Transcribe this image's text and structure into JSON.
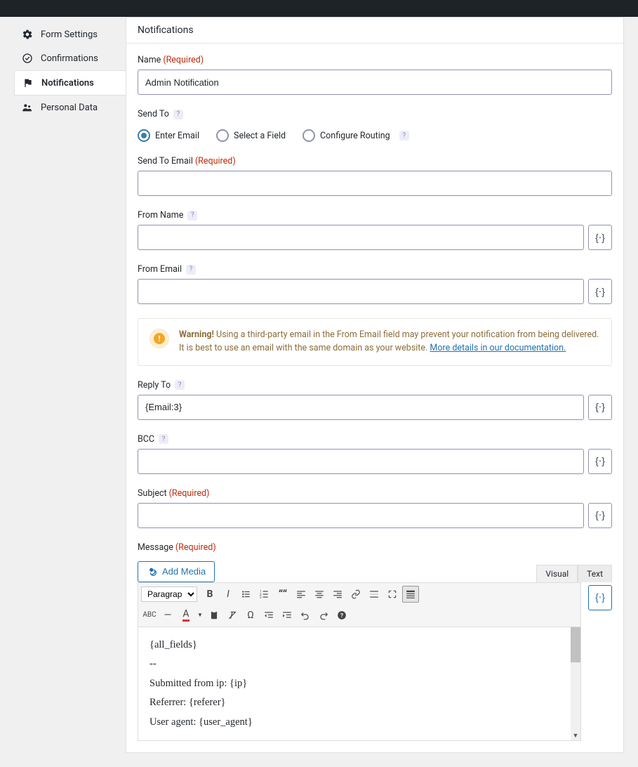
{
  "sidebar": {
    "items": [
      {
        "label": "Form Settings"
      },
      {
        "label": "Confirmations"
      },
      {
        "label": "Notifications"
      },
      {
        "label": "Personal Data"
      }
    ]
  },
  "page": {
    "title": "Notifications"
  },
  "labels": {
    "name": "Name",
    "required": "(Required)",
    "sendTo": "Send To",
    "sendToEmail": "Send To Email",
    "fromName": "From Name",
    "fromEmail": "From Email",
    "replyTo": "Reply To",
    "bcc": "BCC",
    "subject": "Subject",
    "message": "Message"
  },
  "values": {
    "name": "Admin Notification",
    "sendToEmail": "",
    "fromName": "",
    "fromEmail": "",
    "replyTo": "{Email:3}",
    "bcc": "",
    "subject": ""
  },
  "sendToOptions": {
    "enterEmail": "Enter Email",
    "selectField": "Select a Field",
    "configureRouting": "Configure Routing"
  },
  "warning": {
    "bold": "Warning!",
    "text": " Using a third-party email in the From Email field may prevent your notification from being delivered. It is best to use an email with the same domain as your website. ",
    "link": "More details in our documentation."
  },
  "editor": {
    "addMedia": "Add Media",
    "tabVisual": "Visual",
    "tabText": "Text",
    "paragraph": "Paragraph",
    "content": [
      "{all_fields}",
      "--",
      "Submitted from ip: {ip}",
      "Referrer: {referer}",
      "User agent: {user_agent}"
    ]
  }
}
